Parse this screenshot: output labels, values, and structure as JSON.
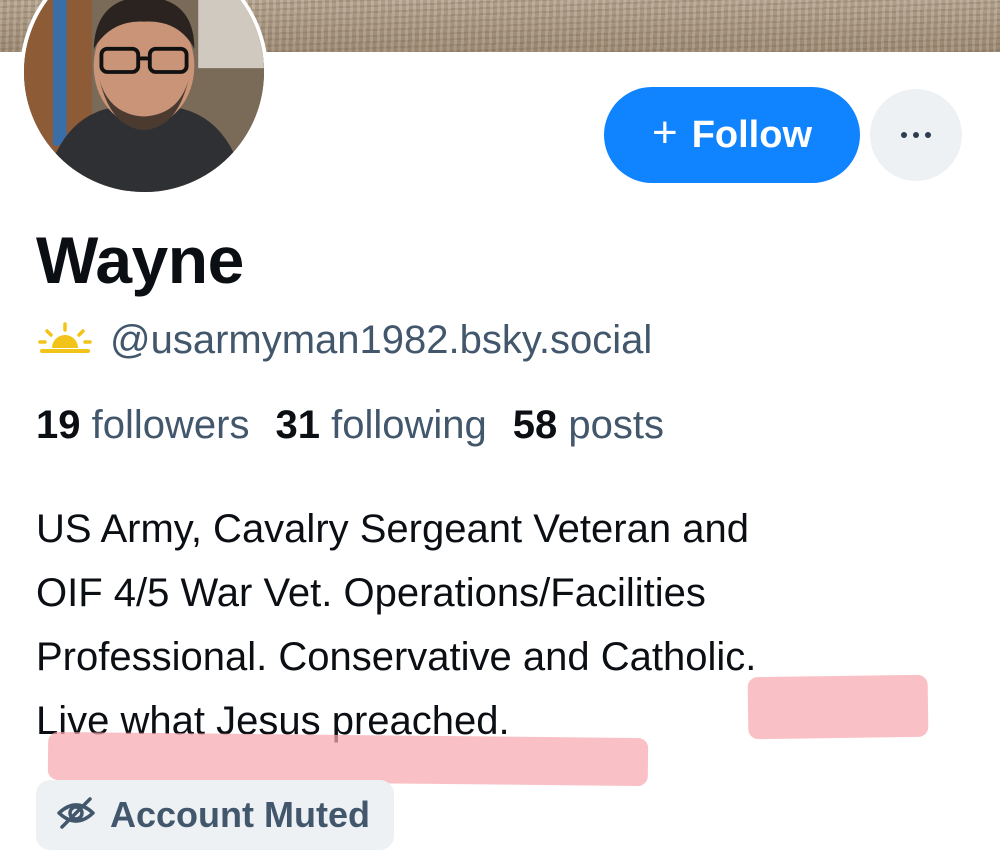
{
  "profile": {
    "display_name": "Wayne",
    "handle": "@usarmyman1982.bsky.social",
    "stats": {
      "followers_count": "19",
      "followers_label": "followers",
      "following_count": "31",
      "following_label": "following",
      "posts_count": "58",
      "posts_label": "posts"
    },
    "bio_lines": [
      "US Army, Cavalry Sergeant Veteran and",
      "OIF 4/5 War Vet. Operations/Facilities",
      "Professional. Conservative and Catholic.",
      "Live what Jesus preached."
    ],
    "muted_badge": "Account Muted"
  },
  "actions": {
    "follow_label": "Follow",
    "follow_icon": "plus-icon",
    "more_icon": "ellipsis-icon"
  },
  "icons": {
    "handle_icon": "sun-icon",
    "muted_icon": "eye-slash-icon"
  },
  "colors": {
    "accent": "#1083fe",
    "secondary_text": "#42576c",
    "highlight": "#f7a9b0",
    "sun": "#f2c318"
  }
}
